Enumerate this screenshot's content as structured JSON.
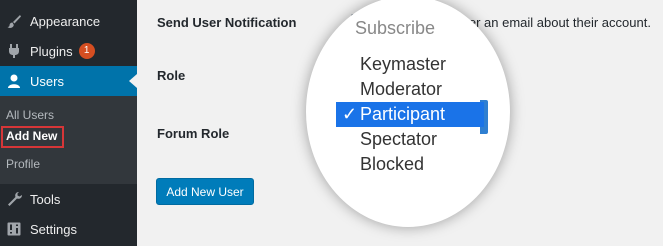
{
  "sidebar": {
    "appearance": "Appearance",
    "plugins": "Plugins",
    "plugins_badge": "1",
    "users": "Users",
    "sub": {
      "all_users": "All Users",
      "add_new": "Add New",
      "profile": "Profile"
    },
    "tools": "Tools",
    "settings": "Settings"
  },
  "form": {
    "send_notification_label": "Send User Notification",
    "send_notification_text": "Send the new user an email about their account.",
    "send_notification_checked": true,
    "role_label": "Role",
    "forum_role_label": "Forum Role",
    "add_button": "Add New User"
  },
  "dropdown": {
    "partial_option": "Subscribe",
    "options": [
      "Keymaster",
      "Moderator",
      "Participant",
      "Spectator",
      "Blocked"
    ],
    "selected": "Participant",
    "check_glyph": "✓"
  },
  "colors": {
    "sidebar_bg": "#23282d",
    "accent": "#0073aa",
    "badge": "#d54e21",
    "highlight_box": "#d63638",
    "button": "#007cba",
    "selected_option": "#1a73e8"
  }
}
